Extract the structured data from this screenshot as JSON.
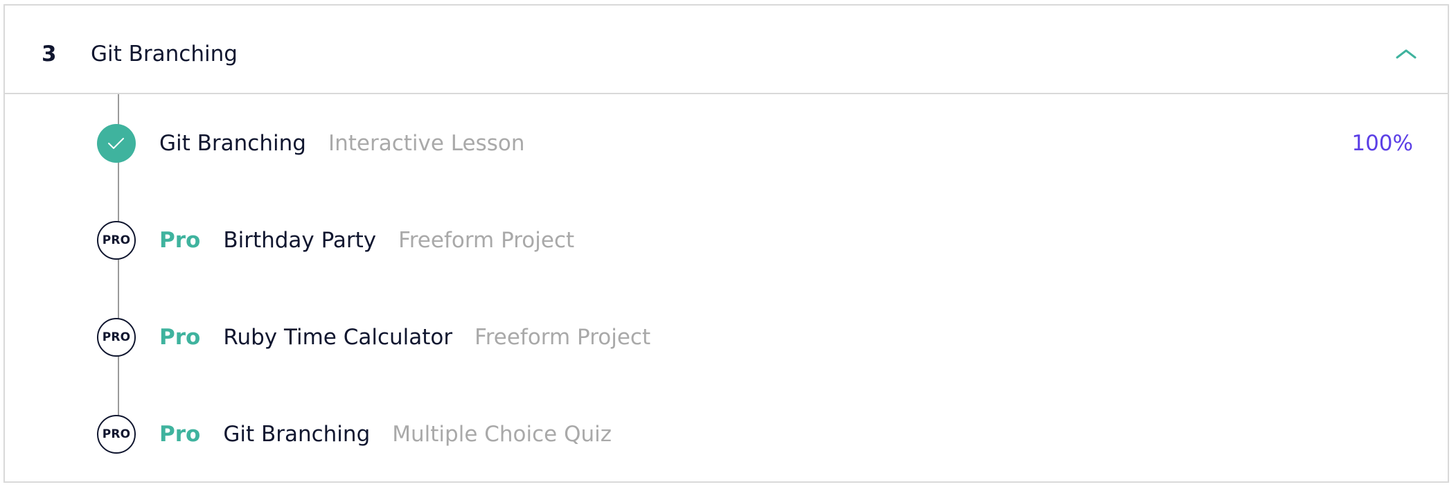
{
  "colors": {
    "accent": "#3fb39e",
    "progress": "#5b3fe6",
    "text_primary": "#10162f",
    "text_muted": "#a9a9a9",
    "divider": "#d9d9d9"
  },
  "module": {
    "number": "3",
    "title": "Git Branching",
    "toggle_icon": "chevron-up-icon"
  },
  "items": [
    {
      "status": "completed",
      "status_icon": "checkmark-icon",
      "title": "Git Branching",
      "type": "Interactive Lesson",
      "progress": "100%"
    },
    {
      "status": "pro",
      "badge": "PRO",
      "pro_label": "Pro",
      "title": "Birthday Party",
      "type": "Freeform Project"
    },
    {
      "status": "pro",
      "badge": "PRO",
      "pro_label": "Pro",
      "title": "Ruby Time Calculator",
      "type": "Freeform Project"
    },
    {
      "status": "pro",
      "badge": "PRO",
      "pro_label": "Pro",
      "title": "Git Branching",
      "type": "Multiple Choice Quiz"
    }
  ]
}
